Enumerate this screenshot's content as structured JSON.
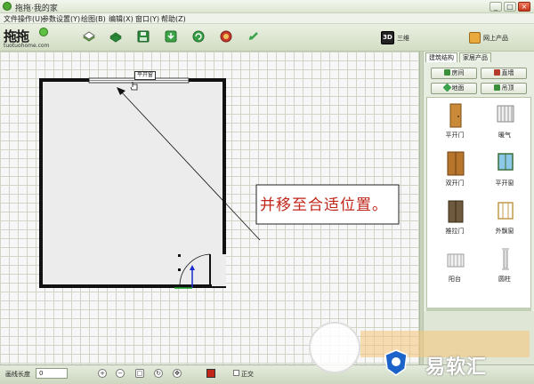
{
  "window": {
    "title": "拖拖·我的家",
    "controls": [
      "_",
      "□",
      "×"
    ]
  },
  "menu": [
    {
      "label": "文件操作(U)"
    },
    {
      "label": "参数设置(Y)"
    },
    {
      "label": "绘图(B)"
    },
    {
      "label": "编辑(X)"
    },
    {
      "label": "窗口(Y)"
    },
    {
      "label": "帮助(Z)"
    }
  ],
  "toolbar": {
    "logo_url": "tuotuohome.com",
    "logo_mark": "拖拖",
    "view3d_box": "3D",
    "view3d_label": "三维",
    "online_label": "网上产品"
  },
  "canvas": {
    "window_tag": "平开窗",
    "callout": "并移至合适位置。"
  },
  "panel": {
    "tabs": [
      "建筑结构",
      "家居产品"
    ],
    "buttons": [
      "房间",
      "直墙",
      "地面",
      "吊顶"
    ],
    "items": [
      {
        "label": "平开门",
        "icon": "door-icon"
      },
      {
        "label": "暖气",
        "icon": "radiator-icon"
      },
      {
        "label": "双开门",
        "icon": "double-door-icon"
      },
      {
        "label": "平开窗",
        "icon": "window-icon"
      },
      {
        "label": "推拉门",
        "icon": "sliding-door-icon"
      },
      {
        "label": "外飘窗",
        "icon": "bay-window-icon"
      },
      {
        "label": "阳台",
        "icon": "balcony-icon"
      },
      {
        "label": "圆柱",
        "icon": "column-icon"
      }
    ]
  },
  "status": {
    "line_length_label": "画线长度",
    "line_length_value": "0",
    "ortho_label": "正交"
  },
  "watermark": {
    "text": "易软汇"
  }
}
